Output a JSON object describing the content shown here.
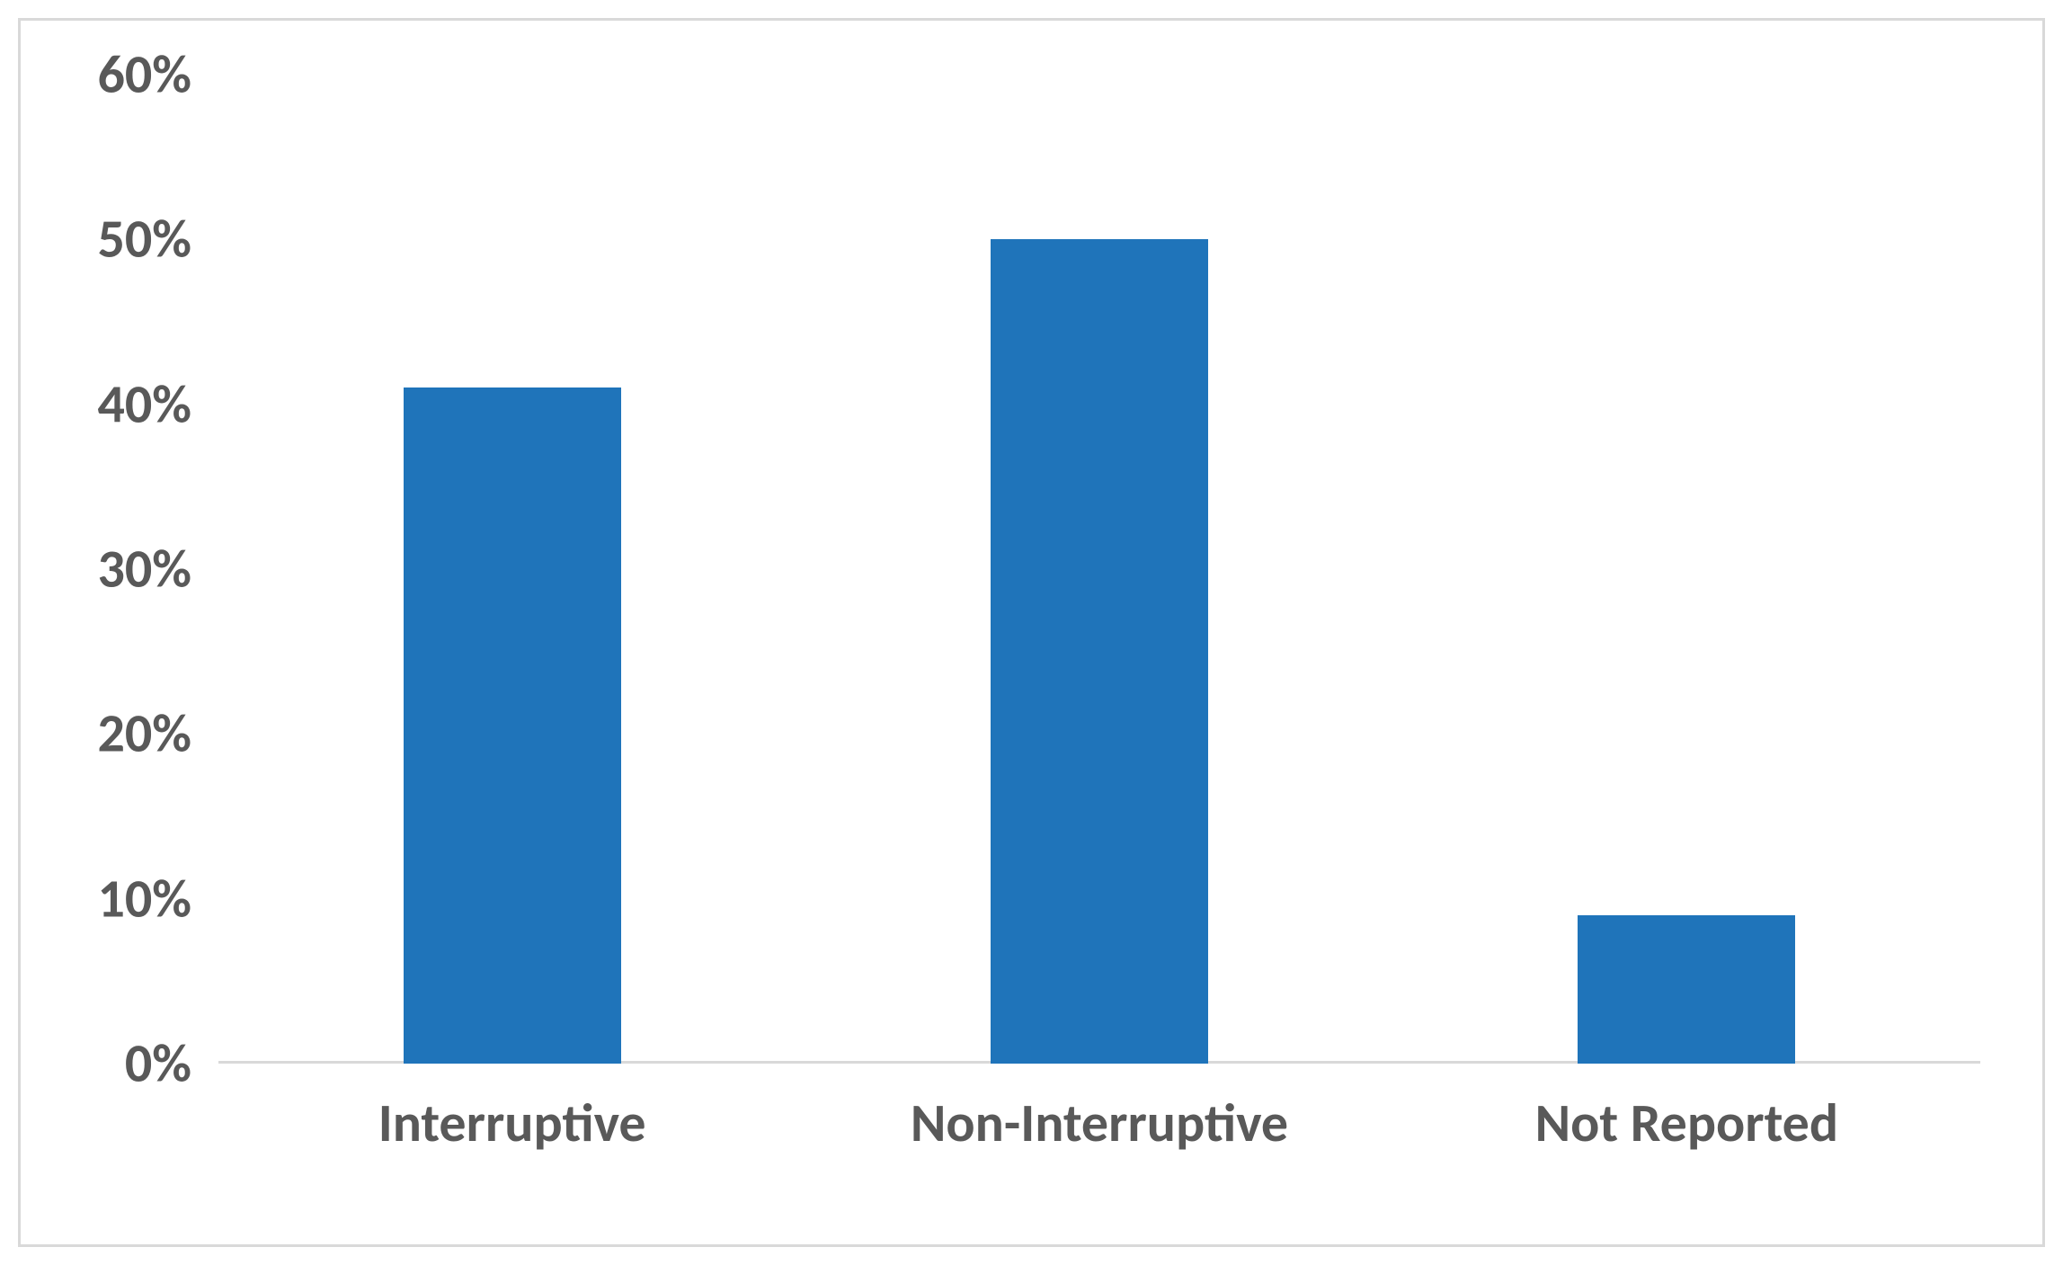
{
  "chart_data": {
    "type": "bar",
    "categories": [
      "Interruptive",
      "Non-Interruptive",
      "Not Reported"
    ],
    "values": [
      41,
      50,
      9
    ],
    "title": "",
    "xlabel": "",
    "ylabel": "",
    "ylim": [
      0,
      60
    ],
    "y_ticks": [
      0,
      10,
      20,
      30,
      40,
      50,
      60
    ],
    "y_tick_labels": [
      "0%",
      "10%",
      "20%",
      "30%",
      "40%",
      "50%",
      "60%"
    ],
    "colors": {
      "bar": "#1f74ba",
      "axis": "#d9d9d9",
      "text": "#595959"
    }
  }
}
